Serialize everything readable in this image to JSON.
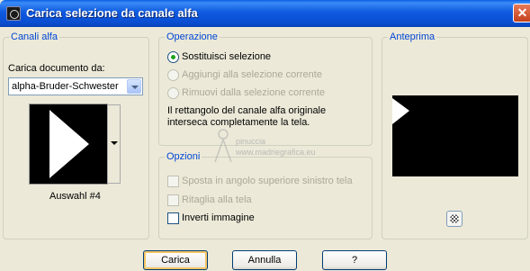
{
  "window": {
    "title": "Carica selezione da canale alfa",
    "close_glyph": "✕"
  },
  "channels": {
    "legend": "Canali alfa",
    "load_label": "Carica documento da:",
    "document_select": "alpha-Bruder-Schwester",
    "selection_name": "Auswahl #4"
  },
  "operation": {
    "legend": "Operazione",
    "options": [
      {
        "label": "Sostituisci selezione",
        "checked": true,
        "enabled": true
      },
      {
        "label": "Aggiungi alla selezione corrente",
        "checked": false,
        "enabled": false
      },
      {
        "label": "Rimuovi dalla selezione corrente",
        "checked": false,
        "enabled": false
      }
    ],
    "info_line1": "Il rettangolo del canale alfa originale",
    "info_line2": "interseca completamente la tela."
  },
  "options": {
    "legend": "Opzioni",
    "items": [
      {
        "label": "Sposta in angolo superiore sinistro tela",
        "checked": false,
        "enabled": false
      },
      {
        "label": "Ritaglia alla tela",
        "checked": false,
        "enabled": false
      },
      {
        "label": "Inverti immagine",
        "checked": false,
        "enabled": true
      }
    ]
  },
  "preview": {
    "legend": "Anteprima"
  },
  "watermark": {
    "line1": "pinuccia",
    "line2": "www.madriegrafica.eu"
  },
  "buttons": {
    "load": "Carica",
    "cancel": "Annulla",
    "help": "?"
  }
}
